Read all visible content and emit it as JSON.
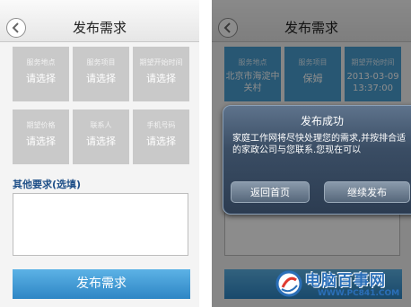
{
  "left_screen": {
    "title": "发布需求",
    "fields": [
      {
        "label": "服务地点",
        "value": "请选择"
      },
      {
        "label": "服务项目",
        "value": "请选择"
      },
      {
        "label": "期望开始时间",
        "value": "请选择"
      },
      {
        "label": "期望价格",
        "value": "请选择"
      },
      {
        "label": "联系人",
        "value": "请选择"
      },
      {
        "label": "手机号码",
        "value": "请选择"
      }
    ],
    "other_label": "其他要求(选填)",
    "submit_label": "发布需求"
  },
  "right_screen": {
    "title": "发布需求",
    "fields": [
      {
        "label": "服务地点",
        "value": "北京市海淀中关村"
      },
      {
        "label": "服务项目",
        "value": "保姆"
      },
      {
        "label": "期望开始时间",
        "value": "2013-03-09 13:37:00"
      }
    ],
    "dialog": {
      "title": "发布成功",
      "message": "家庭工作网将尽快处理您的需求,并按排合适的家政公司与您联系.您现在可以",
      "btn_home": "返回首页",
      "btn_continue": "继续发布"
    }
  },
  "watermark": {
    "name": "电脑百事网",
    "url": "WWW.PC841.COM"
  },
  "colors": {
    "accent": "#4a9fd2",
    "cell_gray": "#c9c9c9",
    "dialog": "#3a4d64"
  }
}
